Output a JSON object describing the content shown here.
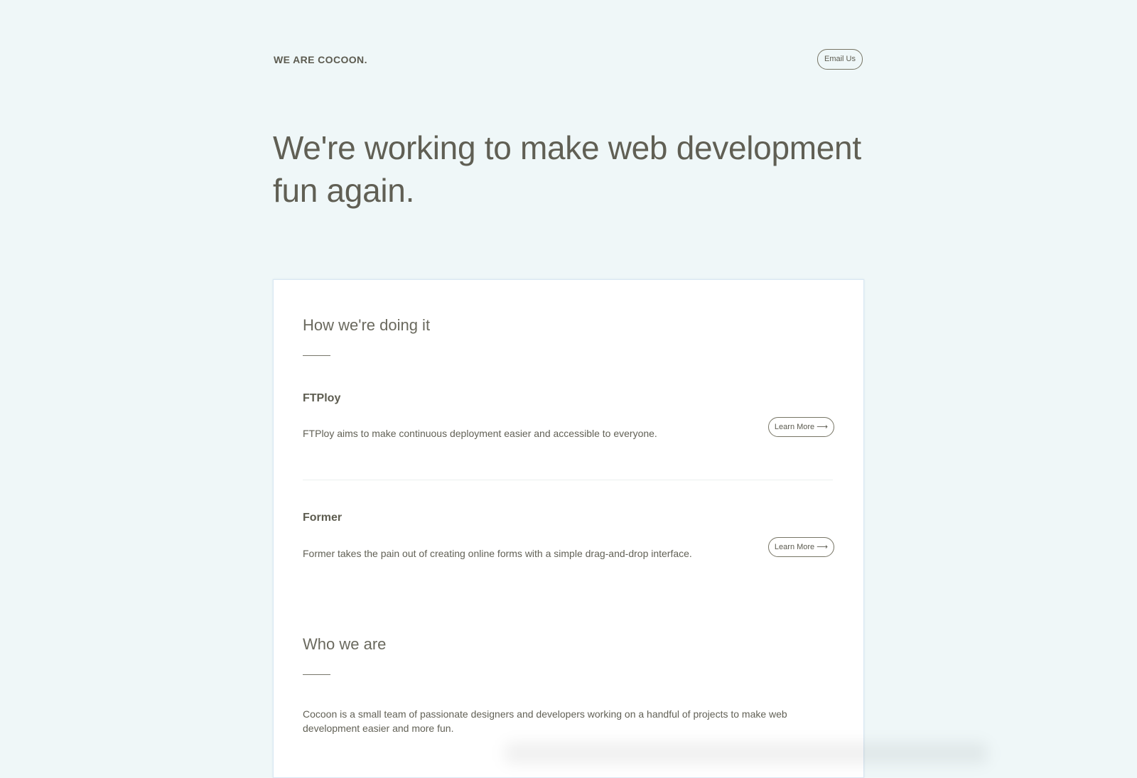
{
  "header": {
    "brand": "WE ARE COCOON.",
    "email_label": "Email Us"
  },
  "hero": {
    "headline": "We're working to make web development fun again."
  },
  "how": {
    "title": "How we're doing it",
    "projects": [
      {
        "name": "FTPloy",
        "description": "FTPloy aims to make continuous deployment easier and accessible to everyone.",
        "button": "Learn More ⟶"
      },
      {
        "name": "Former",
        "description": "Former takes the pain out of creating online forms with a simple drag-and-drop interface.",
        "button": "Learn More ⟶"
      }
    ]
  },
  "who": {
    "title": "Who we are",
    "text": "Cocoon is a small team of passionate designers and developers working on a handful of projects to make web development easier and more fun."
  },
  "colors": {
    "background": "#eff7f8",
    "card": "#ffffff",
    "text": "#5f5e52",
    "card_border": "#d9e7f3"
  }
}
